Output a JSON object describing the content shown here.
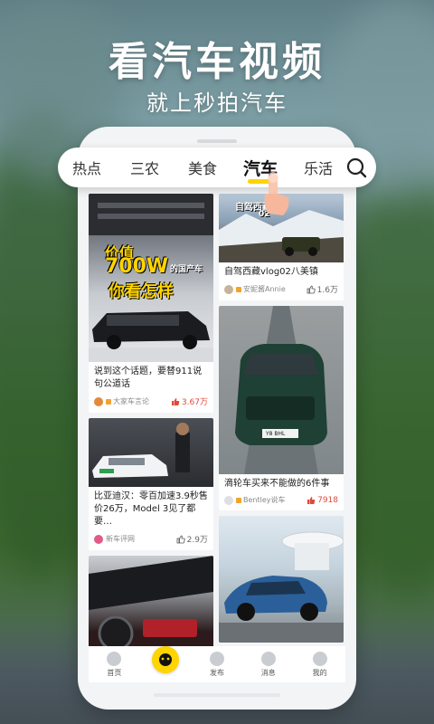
{
  "hero": {
    "title": "看汽车视频",
    "subtitle": "就上秒拍汽车"
  },
  "categories": [
    {
      "label": "热点"
    },
    {
      "label": "三农"
    },
    {
      "label": "美食"
    },
    {
      "label": "汽车",
      "active": true
    },
    {
      "label": "乐活"
    }
  ],
  "feed": {
    "left": [
      {
        "title": "说到这个话题，要替911说句公道话",
        "author": "大家车言论",
        "likes": "3.67万",
        "hot": true,
        "overlay_line1": "价值",
        "overlay_line2": "700W",
        "overlay_small": "的国产车",
        "overlay_line3": "你看怎样"
      },
      {
        "title": "比亚迪汉：零百加速3.9秒售价26万，Model 3见了都要…",
        "author": "新车评网",
        "likes": "2.9万",
        "hot": false,
        "overlay_line1": "",
        "overlay_line2": "",
        "overlay_small": "",
        "overlay_line3": ""
      },
      {
        "title": "",
        "author": "",
        "likes": "",
        "hot": false
      }
    ],
    "right": [
      {
        "title": "自驾西藏vlog02八美镇",
        "author": "安妮酱Annie",
        "likes": "1.6万",
        "hot": false,
        "overlay_line1": "自驾西藏",
        "overlay_line2": "02"
      },
      {
        "title": "滴轮车买来不能做的6件事",
        "author": "Bentley说车",
        "likes": "7918",
        "hot": true,
        "plate": "Y8 BHL"
      },
      {
        "title": "",
        "author": "",
        "likes": "",
        "hot": false
      }
    ]
  },
  "tabbar": [
    {
      "label": "首页",
      "icon": "home-icon"
    },
    {
      "label": "",
      "icon": "camera-icon"
    },
    {
      "label": "发布",
      "icon": "plus-icon"
    },
    {
      "label": "消息",
      "icon": "bell-icon"
    },
    {
      "label": "我的",
      "icon": "user-icon"
    }
  ],
  "colors": {
    "accent": "#ffd400",
    "like_hot": "#e04a3a"
  }
}
